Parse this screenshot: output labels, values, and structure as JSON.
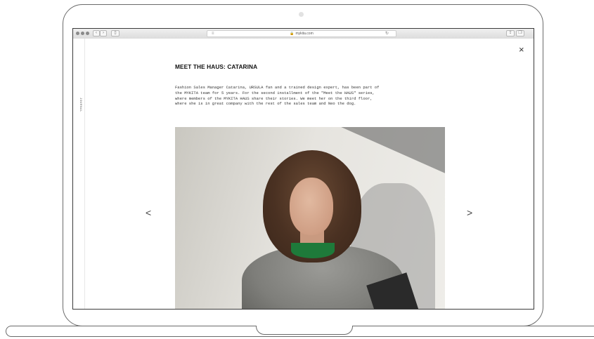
{
  "browser": {
    "url": "mykita.com"
  },
  "page": {
    "side_label": "JOURNAL",
    "title": "MEET THE HAUS: CATARINA",
    "body_lines": [
      "Fashion Sales Manager Catarina, URSULA fan and a trained design expert, has been part of",
      "the MYKITA team for 5 years. For the second installment of the \"Meet the HAUS\" series,",
      "where members of the MYKITA HAUS share their stories. We meet her on the third floor,",
      "where she is in great company with the rest of the sales team and Neo the dog."
    ],
    "close_glyph": "×",
    "prev_glyph": "<",
    "next_glyph": ">"
  },
  "icons": {
    "back": "chevron-left-icon",
    "forward": "chevron-right-icon",
    "sidebar": "sidebar-icon",
    "reader": "reader-icon",
    "lock": "lock-icon",
    "reload": "reload-icon",
    "share": "share-icon",
    "tabs": "tabs-icon"
  }
}
